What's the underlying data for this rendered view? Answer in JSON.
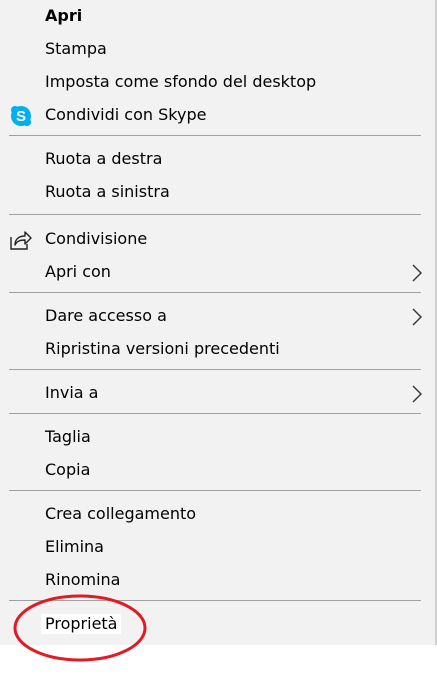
{
  "menu": {
    "items": {
      "apri": "Apri",
      "stampa": "Stampa",
      "sfondo": "Imposta come sfondo del desktop",
      "skype": "Condividi con Skype",
      "ruota_destra": "Ruota a destra",
      "ruota_sinistra": "Ruota a sinistra",
      "condivisione": "Condivisione",
      "apri_con": "Apri con",
      "dare_accesso": "Dare accesso a",
      "ripristina": "Ripristina versioni precedenti",
      "invia_a": "Invia a",
      "taglia": "Taglia",
      "copia": "Copia",
      "crea_collegamento": "Crea collegamento",
      "elimina": "Elimina",
      "rinomina": "Rinomina",
      "proprieta": "Proprietà"
    },
    "icons": {
      "skype": "skype-icon",
      "share": "share-icon",
      "submenu": "chevron-right-icon"
    },
    "colors": {
      "background": "#f2f2f2",
      "separator": "#a0a0a0",
      "skype_blue": "#00aff0",
      "annotation_red": "#e01b24"
    }
  }
}
